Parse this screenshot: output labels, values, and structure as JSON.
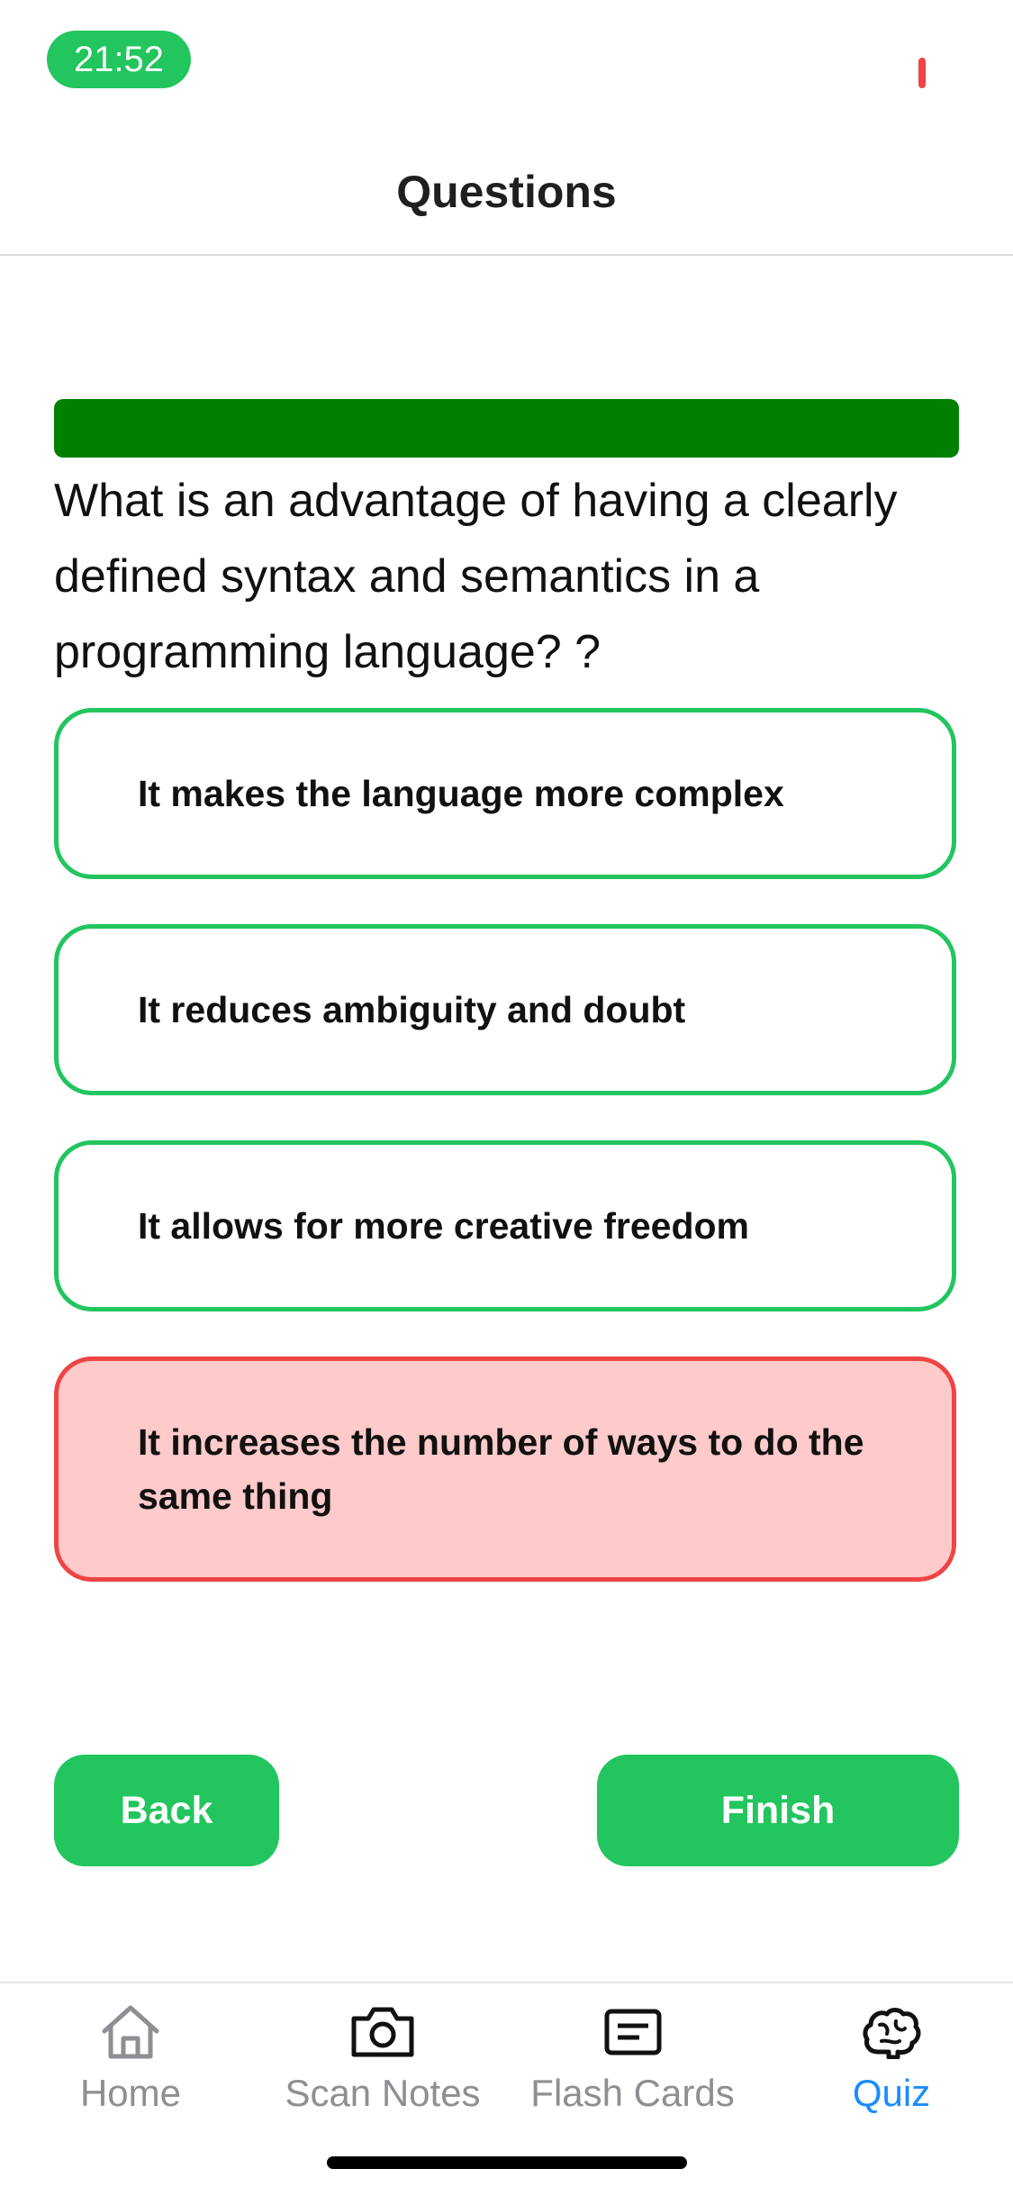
{
  "status_bar": {
    "time": "21:52"
  },
  "header": {
    "title": "Questions"
  },
  "quiz": {
    "progress": 1.0,
    "question": "What is an advantage of having a clearly defined syntax and semantics in a programming language? ?",
    "answers": [
      {
        "text": "It makes the language more complex",
        "state": "default"
      },
      {
        "text": "It reduces ambiguity and doubt",
        "state": "default"
      },
      {
        "text": "It allows for more creative freedom",
        "state": "default"
      },
      {
        "text": "It increases the number of ways to do the same thing",
        "state": "incorrect"
      }
    ]
  },
  "buttons": {
    "back": "Back",
    "finish": "Finish"
  },
  "tabbar": {
    "items": [
      {
        "label": "Home",
        "icon": "house-icon",
        "active": false
      },
      {
        "label": "Scan Notes",
        "icon": "camera-icon",
        "active": false
      },
      {
        "label": "Flash Cards",
        "icon": "card-icon",
        "active": false
      },
      {
        "label": "Quiz",
        "icon": "brain-icon",
        "active": true
      }
    ]
  },
  "colors": {
    "accent_green": "#22c55e",
    "progress_green": "#008000",
    "wrong_red": "#ef4444",
    "wrong_fill": "#fecaca",
    "tab_active": "#1a8cff",
    "tab_inactive": "#8e8e93"
  }
}
